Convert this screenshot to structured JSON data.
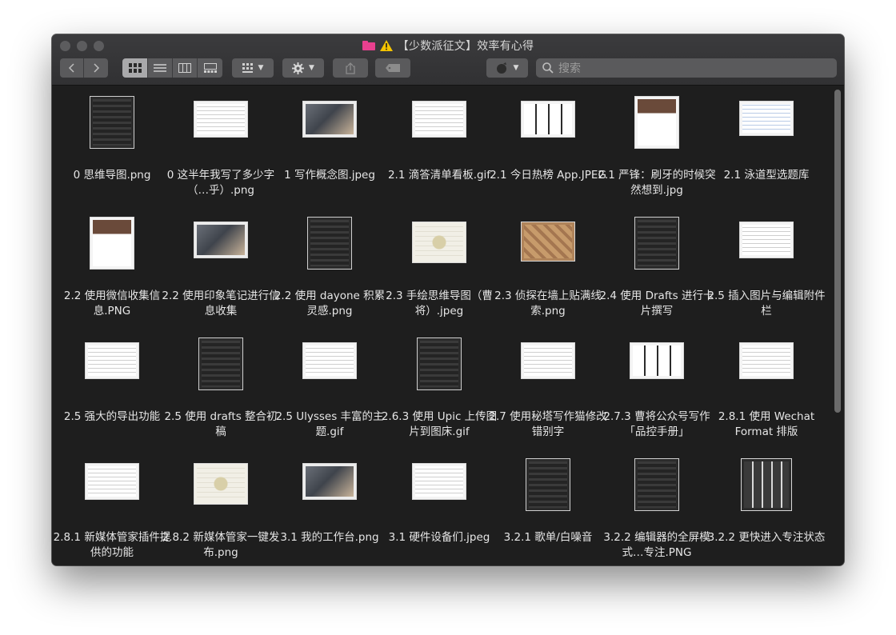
{
  "window": {
    "title": "【少数派征文】效率有心得"
  },
  "toolbar": {
    "search_placeholder": "搜索"
  },
  "files": [
    {
      "name": "0 思维导图.png",
      "style": "dark"
    },
    {
      "name": "0 这半年我写了多少字（…乎）.png",
      "style": "doc"
    },
    {
      "name": "1 写作概念图.jpeg",
      "style": "photo"
    },
    {
      "name": "2.1 滴答清单看板.gif",
      "style": "doc"
    },
    {
      "name": "2.1 今日热榜 App.JPEG",
      "style": "phones"
    },
    {
      "name": "2.1 严锋：刷牙的时候突然想到.jpg",
      "style": "tall"
    },
    {
      "name": "2.1 泳道型选题库",
      "style": "table"
    },
    {
      "name": "2.2 使用微信收集信息.PNG",
      "style": "tall"
    },
    {
      "name": "2.2 使用印象笔记进行信息收集",
      "style": "photo"
    },
    {
      "name": "2.2 使用 dayone 积累灵感.png",
      "style": "dark"
    },
    {
      "name": "2.3 手绘思维导图（曹将）.jpeg",
      "style": "sketch"
    },
    {
      "name": "2.3 侦探在墙上贴满线索.png",
      "style": "cork"
    },
    {
      "name": "2.4 使用 Drafts 进行卡片撰写",
      "style": "dark"
    },
    {
      "name": "2.5 插入图片与编辑附件栏",
      "style": "doc"
    },
    {
      "name": "2.5 强大的导出功能",
      "style": "doc"
    },
    {
      "name": "2.5 使用 drafts 整合初稿",
      "style": "dark"
    },
    {
      "name": "2.5 Ulysses 丰富的主题.gif",
      "style": "doc"
    },
    {
      "name": "2.6.3 使用 Upic 上传图片到图床.gif",
      "style": "dark"
    },
    {
      "name": "2.7 使用秘塔写作猫修改错别字",
      "style": "doc"
    },
    {
      "name": "2.7.3 曹将公众号写作「品控手册」",
      "style": "phones"
    },
    {
      "name": "2.8.1 使用 Wechat Format 排版",
      "style": "doc"
    },
    {
      "name": "2.8.1 新媒体管家插件提供的功能",
      "style": "doc"
    },
    {
      "name": "2.8.2 新媒体管家一键发布.png",
      "style": "sketch"
    },
    {
      "name": "3.1 我的工作台.png",
      "style": "photo"
    },
    {
      "name": "3.1 硬件设备们.jpeg",
      "style": "doc"
    },
    {
      "name": "3.2.1 歌单/白噪音",
      "style": "dark"
    },
    {
      "name": "3.2.2 编辑器的全屏模式…专注.PNG",
      "style": "dark"
    },
    {
      "name": "3.2.2 更快进入专注状态",
      "style": "tall-dark"
    }
  ],
  "colors": {
    "folder": "#e8408f",
    "warning": "#f5c400"
  }
}
